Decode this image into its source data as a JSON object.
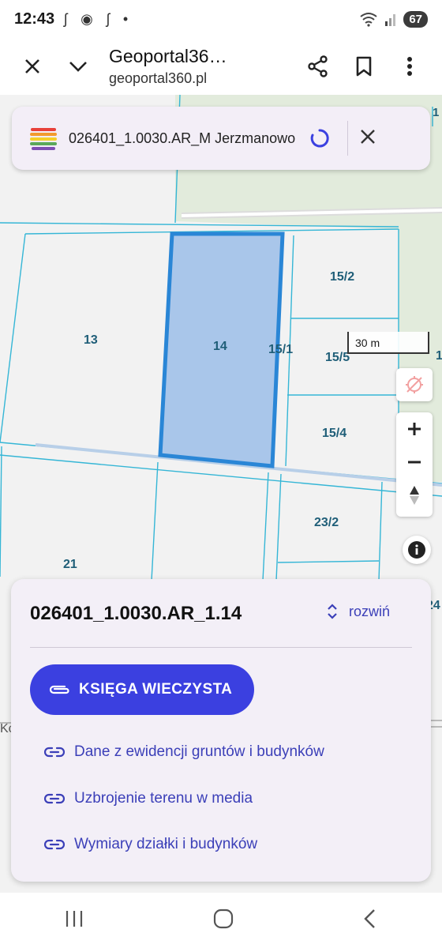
{
  "status": {
    "time": "12:43",
    "notifications": "ʃ ◉ ʃ •",
    "battery": "67"
  },
  "toolbar": {
    "title": "Geoportal36…",
    "url": "geoportal360.pl"
  },
  "search": {
    "query": "026401_1.0030.AR_M Jerzmanowo"
  },
  "map": {
    "plots": [
      "13",
      "14",
      "15/1",
      "15/2",
      "15/5",
      "15/4",
      "23/2",
      "21"
    ],
    "scale": "30 m",
    "partial_labels": [
      "1",
      "Kc",
      "24",
      "1"
    ]
  },
  "panel": {
    "parcel_id": "026401_1.0030.AR_1.14",
    "expand_label": "rozwiń",
    "primary_button": "KSIĘGA WIECZYSTA",
    "links": [
      "Dane z ewidencji gruntów i budynków",
      "Uzbrojenie terenu w media",
      "Wymiary działki i budynków"
    ]
  },
  "colors": {
    "accent": "#3b40e0",
    "link": "#3b3fb8",
    "parcel_fill": "#a9c6ea",
    "parcel_border": "#2a86d6",
    "boundary": "#35b6d6"
  }
}
